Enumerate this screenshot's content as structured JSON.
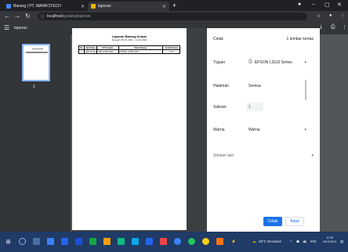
{
  "browser": {
    "tabs": [
      {
        "label": "Barang | PT. MARKOTECH",
        "favicon_color": "#4285f4"
      },
      {
        "label": "laporan",
        "favicon_color": "#f4b400"
      }
    ],
    "url_host": "localhost",
    "url_path": "/gudang/laporan"
  },
  "viewer": {
    "title": "laporan",
    "page_number": "1"
  },
  "document": {
    "title": "Laporan Barang Keluar",
    "subtitle": "Tanggal: 08-10-2021 - 31-10-2021",
    "columns": [
      "No.",
      "Tgl Keluar",
      "ID Transaksi",
      "Nama Barang",
      "Jumlah Keluar"
    ],
    "rows": [
      [
        "1",
        "2021-10-12",
        "T-BK-211012-0001",
        "IPHONE 12 PRO MAX",
        "1 Unit"
      ]
    ]
  },
  "print": {
    "heading": "Cetak",
    "sheet_count": "1 lembar kertas",
    "destination_label": "Tujuan",
    "destination_value": "EPSON L3110 Series",
    "pages_label": "Halaman",
    "pages_value": "Semua",
    "copies_label": "Salinan",
    "copies_value": "1",
    "color_label": "Warna",
    "color_value": "Warna",
    "more_settings": "Setelan lain",
    "print_button": "Cetak",
    "cancel_button": "Batal"
  },
  "taskbar": {
    "weather": "29°C Berawan",
    "clock_time": "10:25",
    "clock_date": "08/11/2021",
    "lang": "IND"
  }
}
